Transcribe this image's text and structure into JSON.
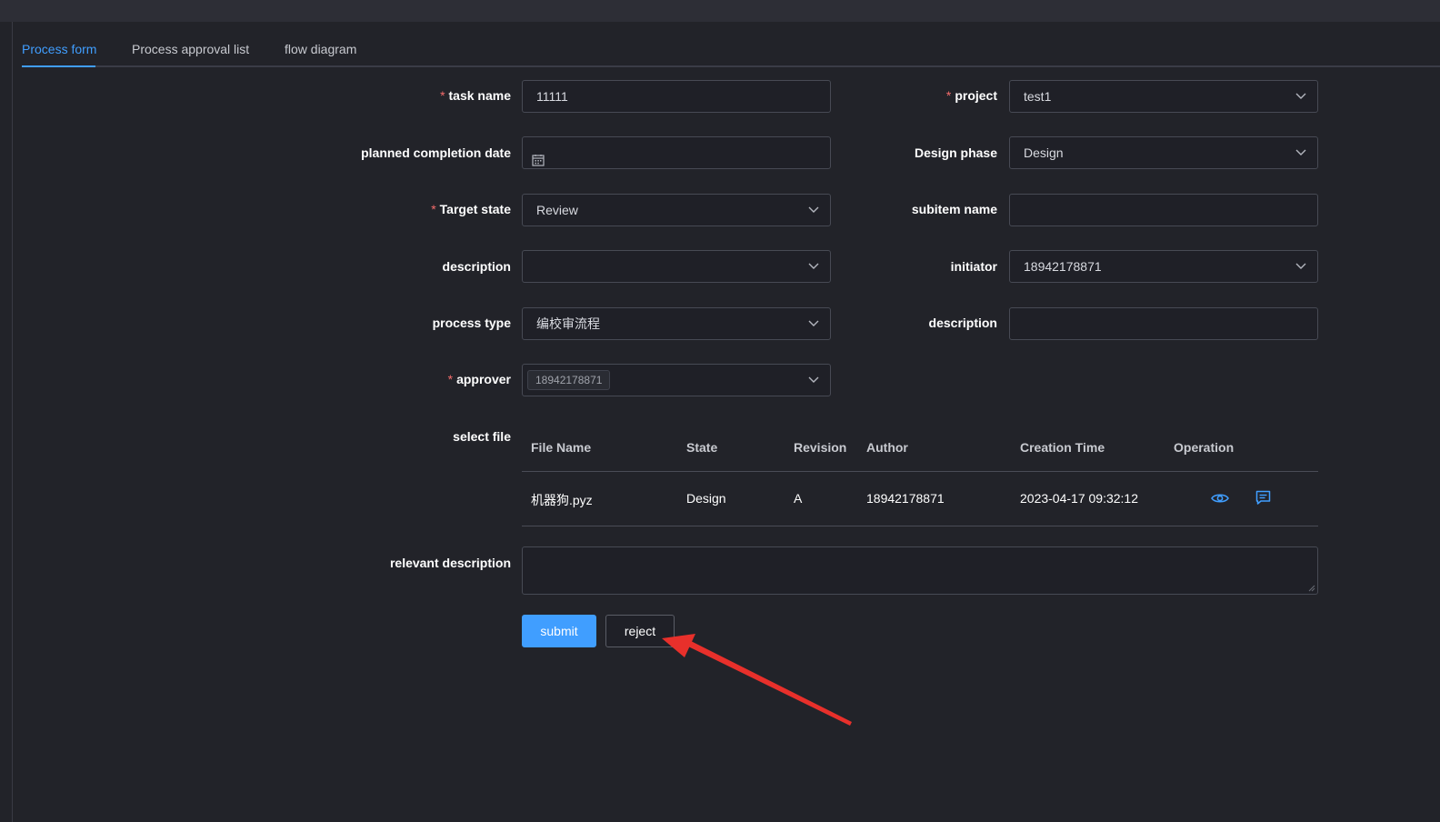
{
  "tabs": [
    {
      "label": "Process form",
      "active": true
    },
    {
      "label": "Process approval list",
      "active": false
    },
    {
      "label": "flow diagram",
      "active": false
    }
  ],
  "form": {
    "required_mark": "*",
    "task_name": {
      "label": "task name",
      "value": "11111"
    },
    "project": {
      "label": "project",
      "value": "test1"
    },
    "planned_completion_date": {
      "label": "planned completion date",
      "value": ""
    },
    "design_phase": {
      "label": "Design phase",
      "value": "Design"
    },
    "target_state": {
      "label": "Target state",
      "value": "Review"
    },
    "subitem_name": {
      "label": "subitem name",
      "value": ""
    },
    "description_select": {
      "label": "description",
      "value": ""
    },
    "initiator": {
      "label": "initiator",
      "value": "18942178871"
    },
    "process_type": {
      "label": "process type",
      "value": "编校审流程"
    },
    "description_input": {
      "label": "description",
      "value": ""
    },
    "approver": {
      "label": "approver",
      "tag": "18942178871"
    },
    "select_file": {
      "label": "select file"
    },
    "relevant_description": {
      "label": "relevant description",
      "value": ""
    }
  },
  "file_table": {
    "columns": [
      "File Name",
      "State",
      "Revision",
      "Author",
      "Creation Time",
      "Operation"
    ],
    "rows": [
      {
        "file_name": "机器狗.pyz",
        "state": "Design",
        "revision": "A",
        "author": "18942178871",
        "creation_time": "2023-04-17 09:32:12",
        "ops": [
          "eye-icon",
          "comment-icon"
        ]
      }
    ]
  },
  "buttons": {
    "submit": "submit",
    "reject": "reject"
  },
  "colors": {
    "accent": "#409eff",
    "required": "#f56c6c",
    "background": "#222329",
    "annotation_arrow": "#e8302b"
  }
}
